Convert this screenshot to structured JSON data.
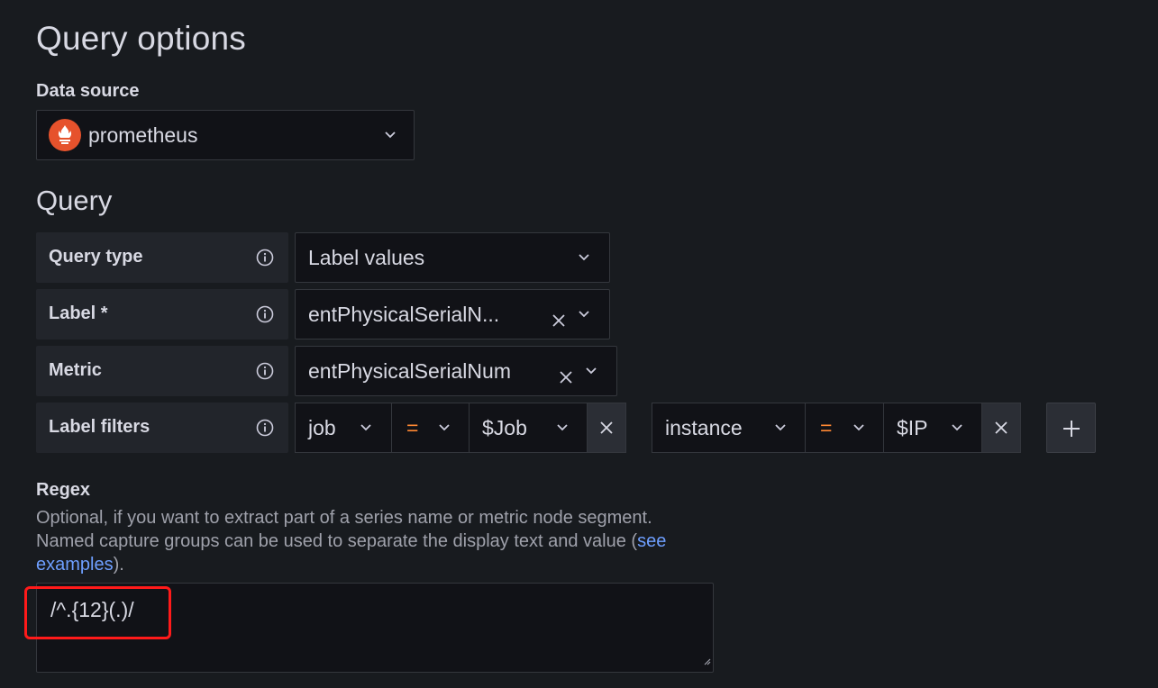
{
  "page": {
    "title": "Query options"
  },
  "data_source": {
    "label": "Data source",
    "value": "prometheus",
    "logo_color": "#e6522c"
  },
  "query": {
    "title": "Query",
    "rows": [
      {
        "label": "Query type",
        "value": "Label values"
      },
      {
        "label": "Label *",
        "value": "entPhysicalSerialN..."
      },
      {
        "label": "Metric",
        "value": "entPhysicalSerialNum"
      },
      {
        "label": "Label filters"
      }
    ],
    "filters": [
      {
        "key": "job",
        "op": "=",
        "value": "$Job"
      },
      {
        "key": "instance",
        "op": "=",
        "value": "$IP"
      }
    ]
  },
  "regex": {
    "label": "Regex",
    "description_line1": "Optional, if you want to extract part of a series name or metric node segment.",
    "description_line2_pre": "Named capture groups can be used to separate the display text and value (",
    "link_text_1": "see",
    "link_text_2": "examples",
    "description_end": ").",
    "value": "/^.{12}(.)/"
  },
  "colors": {
    "background": "#181b1f",
    "operator": "#ff8833",
    "link": "#6e9fff",
    "highlight": "#ff1a1a"
  }
}
